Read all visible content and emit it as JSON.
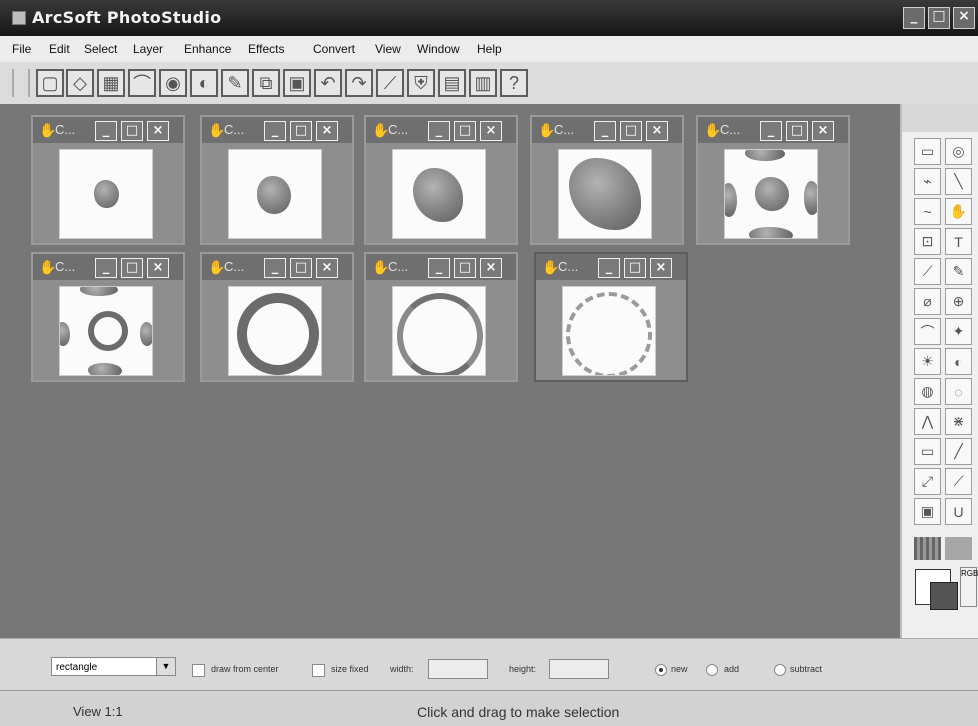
{
  "app": {
    "title": "ArcSoft PhotoStudio",
    "window_controls": [
      "_",
      "□",
      "×"
    ]
  },
  "menu": [
    "File",
    "Edit",
    "Select",
    "Layer",
    "Enhance",
    "Effects",
    "Convert",
    "View",
    "Window",
    "Help"
  ],
  "toolbar": [
    {
      "name": "new"
    },
    {
      "name": "open"
    },
    {
      "name": "save"
    },
    {
      "name": "print"
    },
    {
      "name": "scanner"
    },
    {
      "name": "camera"
    },
    {
      "name": "brush"
    },
    {
      "name": "copy"
    },
    {
      "name": "paste"
    },
    {
      "name": "undo"
    },
    {
      "name": "redo"
    },
    {
      "name": "wand"
    },
    {
      "name": "shirt"
    },
    {
      "name": "color"
    },
    {
      "name": "film"
    },
    {
      "name": "help",
      "glyph": "?"
    }
  ],
  "documents": [
    {
      "title": "C...",
      "buttons": [
        "_",
        "□",
        "×"
      ]
    },
    {
      "title": "C...",
      "buttons": [
        "_",
        "□",
        "×"
      ]
    },
    {
      "title": "C...",
      "buttons": [
        "_",
        "□",
        "×"
      ]
    },
    {
      "title": "C...",
      "buttons": [
        "_",
        "□",
        "×"
      ]
    },
    {
      "title": "C...",
      "buttons": [
        "_",
        "□",
        "×"
      ]
    },
    {
      "title": "C...",
      "buttons": [
        "_",
        "□",
        "×"
      ]
    },
    {
      "title": "C...",
      "buttons": [
        "_",
        "□",
        "×"
      ]
    },
    {
      "title": "C...",
      "buttons": [
        "_",
        "□",
        "×"
      ]
    },
    {
      "title": "C...",
      "buttons": [
        "_",
        "□",
        "×"
      ]
    }
  ],
  "tool_panel": {
    "tools": [
      "select-rect",
      "move",
      "lasso",
      "line",
      "freehand",
      "hand",
      "crop",
      "text",
      "paintbrush",
      "pencil",
      "eraser",
      "stamp",
      "smudge",
      "magic-brush",
      "sun",
      "burn",
      "sponge",
      "blur",
      "sharpen",
      "pattern",
      "rectangle",
      "line2",
      "resize",
      "eyedropper",
      "fill",
      "trash"
    ],
    "rgb_label": "RGB"
  },
  "selection_options": {
    "shape": "rectangle",
    "draw_from_center": "draw from center",
    "size_fixed": "size fixed",
    "width": "width:",
    "height": "height:",
    "new": "new",
    "add": "add",
    "subtract": "subtract"
  },
  "status": {
    "view": "View 1:1",
    "message": "Click and drag to make selection"
  }
}
